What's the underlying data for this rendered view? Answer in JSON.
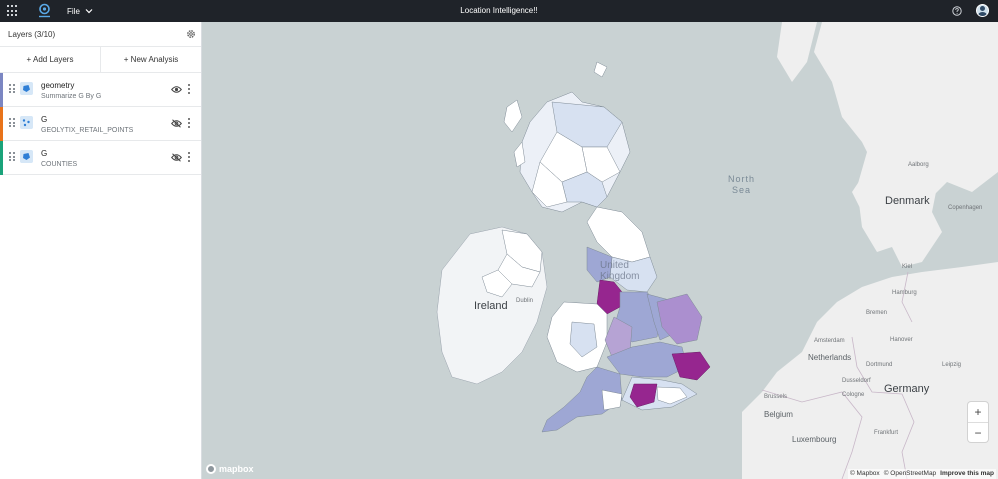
{
  "topbar": {
    "title": "Location Intelligence!!",
    "file_menu": "File",
    "icons": [
      "app-grid-icon",
      "logo-pin-icon",
      "chevron-down-icon",
      "help-icon",
      "avatar"
    ]
  },
  "sidebar": {
    "title": "Layers (3/10)",
    "add_layers": "+ Add Layers",
    "new_analysis": "+ New Analysis",
    "layers": [
      {
        "name": "geometry",
        "subtitle": "Summarize G By G",
        "color": "#7b86c2",
        "visible": true,
        "icon": "polygon-layer-icon"
      },
      {
        "name": "G",
        "subtitle": "GEOLYTIX_RETAIL_POINTS",
        "color": "#e8731a",
        "visible": false,
        "icon": "points-layer-icon"
      },
      {
        "name": "G",
        "subtitle": "COUNTIES",
        "color": "#1aa37a",
        "visible": false,
        "icon": "polygon-layer-icon"
      }
    ]
  },
  "map": {
    "labels": {
      "north_sea_1": "North",
      "north_sea_2": "Sea",
      "ireland": "Ireland",
      "denmark": "Denmark",
      "netherlands": "Netherlands",
      "belgium": "Belgium",
      "germany": "Germany",
      "luxembourg": "Luxembourg",
      "united_kingdom": "United Kingdom",
      "dublin": "Dublin",
      "hamburg": "Hamburg",
      "bremen": "Bremen",
      "hanover": "Hanover",
      "amsterdam": "Amsterdam",
      "brussels": "Brussels",
      "dusseldorf": "Dusseldorf",
      "cologne": "Cologne",
      "frankfurt": "Frankfurt",
      "copenhagen": "Copenhagen",
      "aalborg": "Aalborg",
      "kiel": "Kiel",
      "dortmund": "Dortmund",
      "leipzig": "Leipzig"
    },
    "zoom_in": "+",
    "zoom_out": "−",
    "mapbox_logo": "mapbox",
    "attribution": [
      "© Mapbox",
      "© OpenStreetMap",
      "Improve this map"
    ],
    "colors": {
      "water": "#c9d2d3",
      "land": "#efefef",
      "low": "#dbe6f4",
      "mid": "#9ea7d4",
      "high": "#7f5fb0",
      "top": "#96268f"
    }
  }
}
